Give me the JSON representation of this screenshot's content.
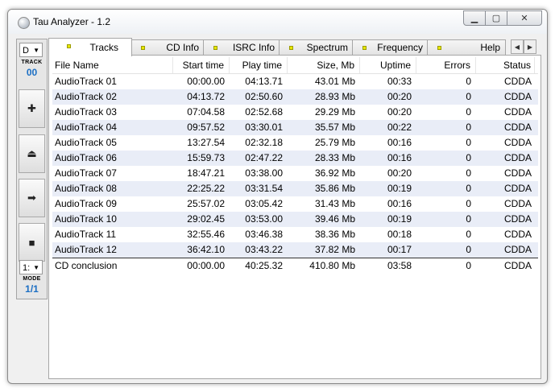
{
  "window": {
    "title": "Tau Analyzer - 1.2"
  },
  "toolbar": {
    "drive": "D",
    "track_label": "TRACK",
    "track_number": "00",
    "buttons": [
      {
        "name": "add-button",
        "icon": "plus-icon",
        "glyph": "✚"
      },
      {
        "name": "eject-button",
        "icon": "eject-icon",
        "glyph": "⏏"
      },
      {
        "name": "forward-button",
        "icon": "arrow-right-icon",
        "glyph": "➡"
      },
      {
        "name": "stop-button",
        "icon": "stop-icon",
        "glyph": "■"
      }
    ],
    "mode_select": "1:",
    "mode_label": "MODE",
    "mode_value": "1/1"
  },
  "tabs": [
    {
      "label": "Tracks",
      "active": true
    },
    {
      "label": "CD Info"
    },
    {
      "label": "ISRC Info"
    },
    {
      "label": "Spectrum"
    },
    {
      "label": "Frequency"
    },
    {
      "label": "Help"
    }
  ],
  "table": {
    "columns": [
      "File Name",
      "Start time",
      "Play time",
      "Size, Mb",
      "Uptime",
      "Errors",
      "Status"
    ],
    "rows": [
      [
        "AudioTrack 01",
        "00:00.00",
        "04:13.71",
        "43.01 Mb",
        "00:33",
        "0",
        "CDDA"
      ],
      [
        "AudioTrack 02",
        "04:13.72",
        "02:50.60",
        "28.93 Mb",
        "00:20",
        "0",
        "CDDA"
      ],
      [
        "AudioTrack 03",
        "07:04.58",
        "02:52.68",
        "29.29 Mb",
        "00:20",
        "0",
        "CDDA"
      ],
      [
        "AudioTrack 04",
        "09:57.52",
        "03:30.01",
        "35.57 Mb",
        "00:22",
        "0",
        "CDDA"
      ],
      [
        "AudioTrack 05",
        "13:27.54",
        "02:32.18",
        "25.79 Mb",
        "00:16",
        "0",
        "CDDA"
      ],
      [
        "AudioTrack 06",
        "15:59.73",
        "02:47.22",
        "28.33 Mb",
        "00:16",
        "0",
        "CDDA"
      ],
      [
        "AudioTrack 07",
        "18:47.21",
        "03:38.00",
        "36.92 Mb",
        "00:20",
        "0",
        "CDDA"
      ],
      [
        "AudioTrack 08",
        "22:25.22",
        "03:31.54",
        "35.86 Mb",
        "00:19",
        "0",
        "CDDA"
      ],
      [
        "AudioTrack 09",
        "25:57.02",
        "03:05.42",
        "31.43 Mb",
        "00:16",
        "0",
        "CDDA"
      ],
      [
        "AudioTrack 10",
        "29:02.45",
        "03:53.00",
        "39.46 Mb",
        "00:19",
        "0",
        "CDDA"
      ],
      [
        "AudioTrack 11",
        "32:55.46",
        "03:46.38",
        "38.36 Mb",
        "00:18",
        "0",
        "CDDA"
      ],
      [
        "AudioTrack 12",
        "36:42.10",
        "03:43.22",
        "37.82 Mb",
        "00:17",
        "0",
        "CDDA"
      ]
    ],
    "summary": [
      "CD conclusion",
      "00:00.00",
      "40:25.32",
      "410.80 Mb",
      "03:58",
      "0",
      "CDDA"
    ]
  }
}
